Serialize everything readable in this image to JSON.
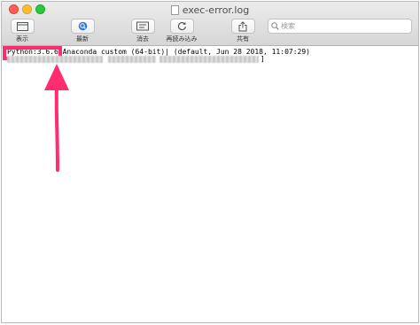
{
  "window": {
    "title": "exec-error.log"
  },
  "toolbar": {
    "display_label": "表示",
    "refresh_label": "最新",
    "clear_label": "消去",
    "reload_label": "再読み込み",
    "share_label": "共有",
    "search_placeholder": "検索"
  },
  "log": {
    "highlighted_text": "Python:3.6.6",
    "line1_rest": " Anaconda custom (64-bit)| (default, Jun 28 2018, 11:07:29)",
    "line2_end": "]"
  },
  "colors": {
    "highlight": "#ff2d6f",
    "arrow": "#ff2d6f"
  }
}
